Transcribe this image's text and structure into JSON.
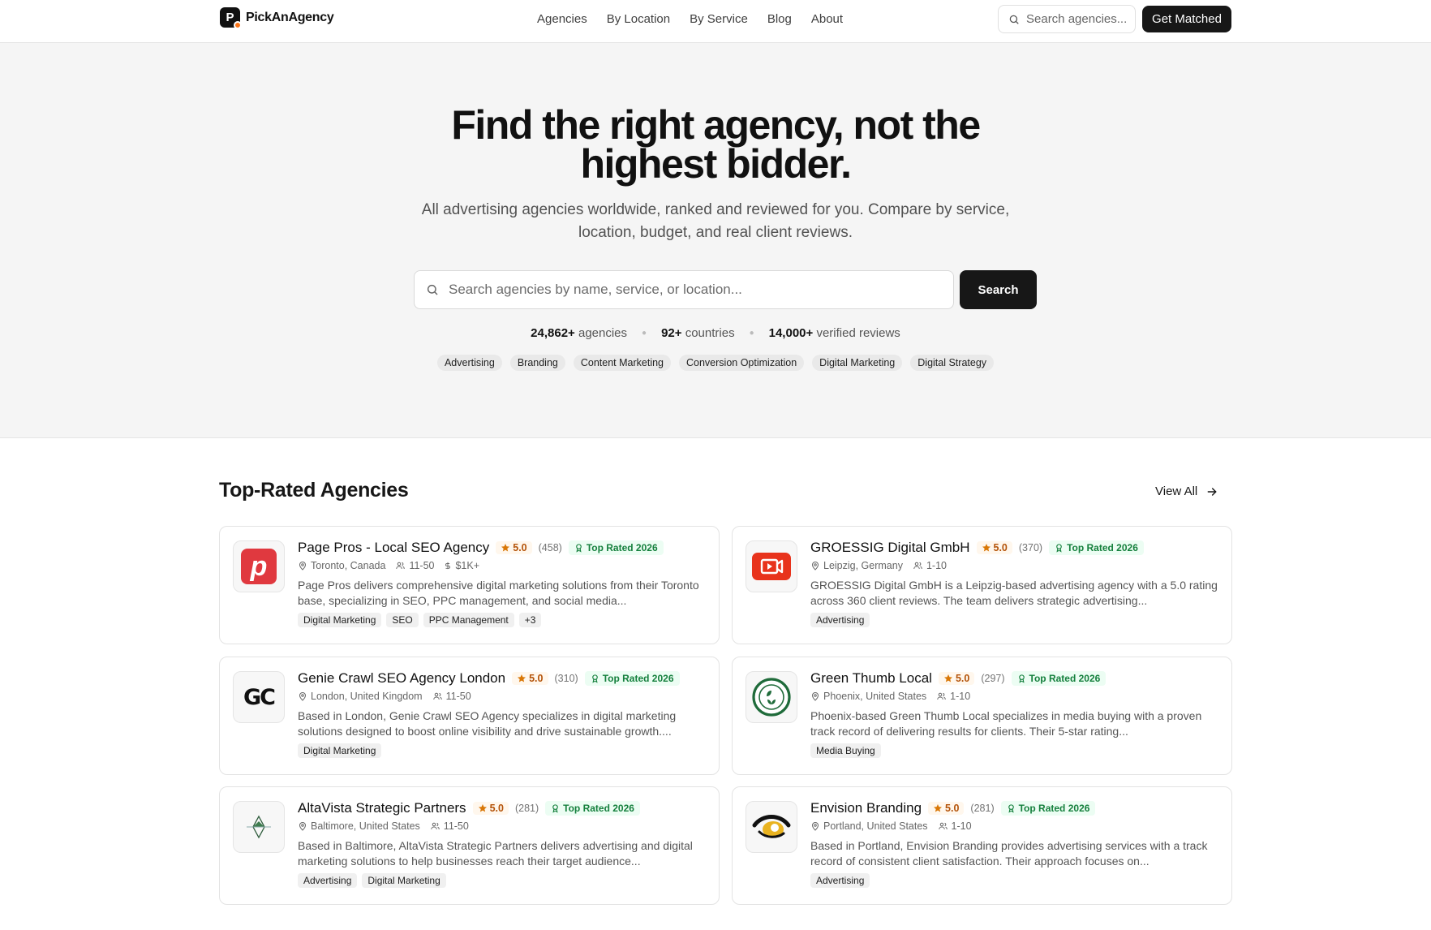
{
  "header": {
    "brand": "PickAnAgency",
    "brand_initial": "P",
    "nav": [
      "Agencies",
      "By Location",
      "By Service",
      "Blog",
      "About"
    ],
    "search_placeholder": "Search agencies...",
    "cta": "Get Matched"
  },
  "hero": {
    "title_line1": "Find the right agency, not the",
    "title_line2": "highest bidder.",
    "subtitle": "All advertising agencies worldwide, ranked and reviewed for you. Compare by service, location, budget, and real client reviews.",
    "search_placeholder": "Search agencies by name, service, or location...",
    "search_button": "Search",
    "stats": [
      {
        "value": "24,862+",
        "label": "agencies"
      },
      {
        "value": "92+",
        "label": "countries"
      },
      {
        "value": "14,000+",
        "label": "verified reviews"
      }
    ],
    "chips": [
      "Advertising",
      "Branding",
      "Content Marketing",
      "Conversion Optimization",
      "Digital Marketing",
      "Digital Strategy"
    ]
  },
  "section": {
    "title": "Top-Rated Agencies",
    "view_all": "View All"
  },
  "agencies": [
    {
      "name": "Page Pros - Local SEO Agency",
      "rating": "5.0",
      "reviews": "(458)",
      "badge": "Top Rated 2026",
      "location": "Toronto, Canada",
      "size": "11-50",
      "budget": "$1K+",
      "description": "Page Pros delivers comprehensive digital marketing solutions from their Toronto base, specializing in SEO, PPC management, and social media...",
      "tags": [
        "Digital Marketing",
        "SEO",
        "PPC Management",
        "+3"
      ],
      "logo": "page-pros-logo"
    },
    {
      "name": "GROESSIG Digital GmbH",
      "rating": "5.0",
      "reviews": "(370)",
      "badge": "Top Rated 2026",
      "location": "Leipzig, Germany",
      "size": "1-10",
      "budget": "",
      "description": "GROESSIG Digital GmbH is a Leipzig-based advertising agency with a 5.0 rating across 360 client reviews. The team delivers strategic advertising...",
      "tags": [
        "Advertising"
      ],
      "logo": "groessig-logo"
    },
    {
      "name": "Genie Crawl SEO Agency London",
      "rating": "5.0",
      "reviews": "(310)",
      "badge": "Top Rated 2026",
      "location": "London, United Kingdom",
      "size": "11-50",
      "budget": "",
      "description": "Based in London, Genie Crawl SEO Agency specializes in digital marketing solutions designed to boost online visibility and drive sustainable growth....",
      "tags": [
        "Digital Marketing"
      ],
      "logo": "genie-crawl-logo"
    },
    {
      "name": "Green Thumb Local",
      "rating": "5.0",
      "reviews": "(297)",
      "badge": "Top Rated 2026",
      "location": "Phoenix, United States",
      "size": "1-10",
      "budget": "",
      "description": "Phoenix-based Green Thumb Local specializes in media buying with a proven track record of delivering results for clients. Their 5-star rating...",
      "tags": [
        "Media Buying"
      ],
      "logo": "green-thumb-logo"
    },
    {
      "name": "AltaVista Strategic Partners",
      "rating": "5.0",
      "reviews": "(281)",
      "badge": "Top Rated 2026",
      "location": "Baltimore, United States",
      "size": "11-50",
      "budget": "",
      "description": "Based in Baltimore, AltaVista Strategic Partners delivers advertising and digital marketing solutions to help businesses reach their target audience...",
      "tags": [
        "Advertising",
        "Digital Marketing"
      ],
      "logo": "altavista-logo"
    },
    {
      "name": "Envision Branding",
      "rating": "5.0",
      "reviews": "(281)",
      "badge": "Top Rated 2026",
      "location": "Portland, United States",
      "size": "1-10",
      "budget": "",
      "description": "Based in Portland, Envision Branding provides advertising services with a track record of consistent client satisfaction. Their approach focuses on...",
      "tags": [
        "Advertising"
      ],
      "logo": "envision-logo"
    }
  ],
  "logo_text": {
    "page_pros": "p",
    "genie": "GC"
  },
  "colors": {
    "accent": "#171717",
    "rating": "#b45309",
    "badge_green": "#15803d",
    "page_pros_red": "#e0393f",
    "groessig_red": "#e8331c",
    "green_thumb": "#1f6b3a",
    "envision_yellow": "#e9b320"
  }
}
